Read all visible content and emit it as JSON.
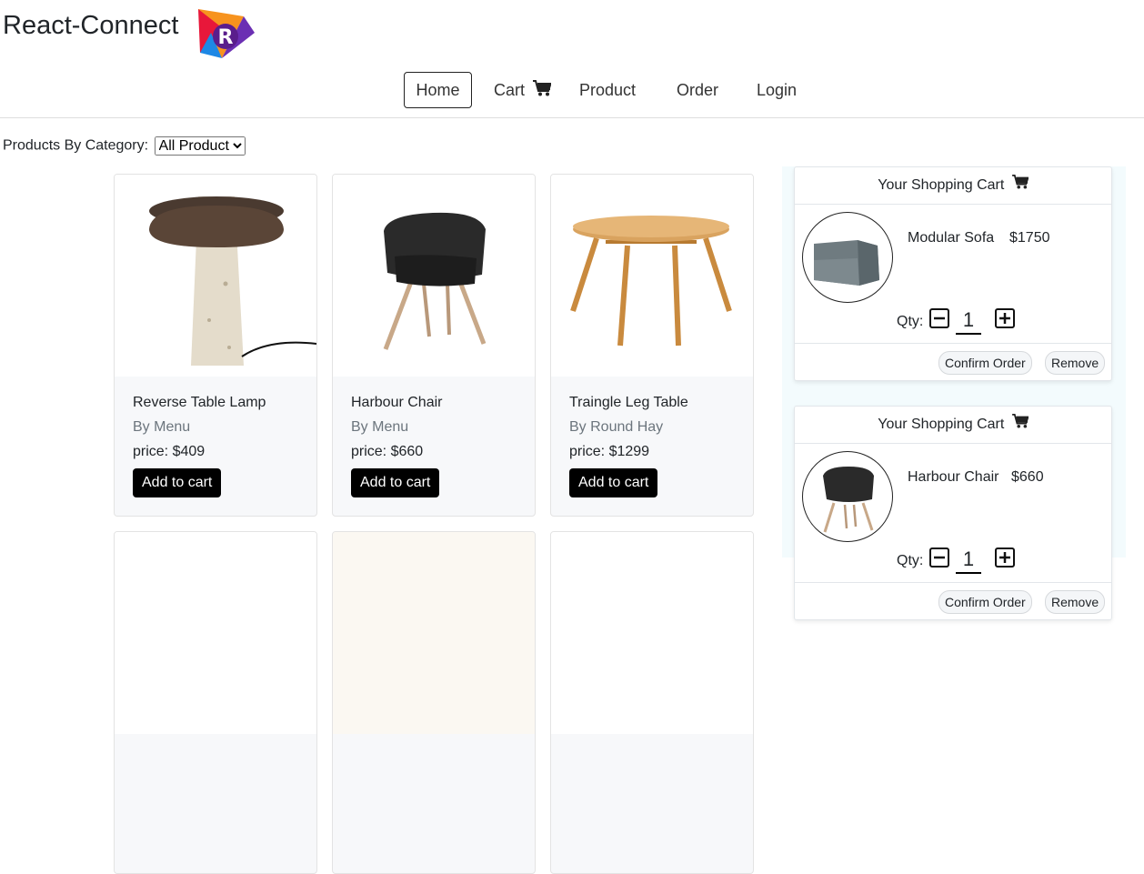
{
  "header": {
    "brand": "React-Connect",
    "logo_letter": "R"
  },
  "nav": {
    "home": "Home",
    "cart": "Cart",
    "product": "Product",
    "order": "Order",
    "login": "Login",
    "active": "Home"
  },
  "filter": {
    "label": "Products By Category:",
    "selected": "All Product"
  },
  "products": [
    {
      "name": "Reverse Table Lamp",
      "maker": "By Menu",
      "price": "price: $409",
      "button": "Add to cart"
    },
    {
      "name": "Harbour Chair",
      "maker": "By Menu",
      "price": "price: $660",
      "button": "Add to cart"
    },
    {
      "name": "Traingle Leg Table",
      "maker": "By Round Hay",
      "price": "price: $1299",
      "button": "Add to cart"
    }
  ],
  "cart": {
    "items": [
      {
        "header": "Your Shopping Cart",
        "name": "Modular Sofa",
        "price": "$1750",
        "qty_label": "Qty:",
        "qty": "1",
        "confirm": "Confirm Order",
        "remove": "Remove"
      },
      {
        "header": "Your Shopping Cart",
        "name": "Harbour Chair",
        "price": "$660",
        "qty_label": "Qty:",
        "qty": "1",
        "confirm": "Confirm Order",
        "remove": "Remove"
      }
    ]
  },
  "colors": {
    "button_bg": "#000000",
    "panel_bg": "#f3fbfd"
  }
}
